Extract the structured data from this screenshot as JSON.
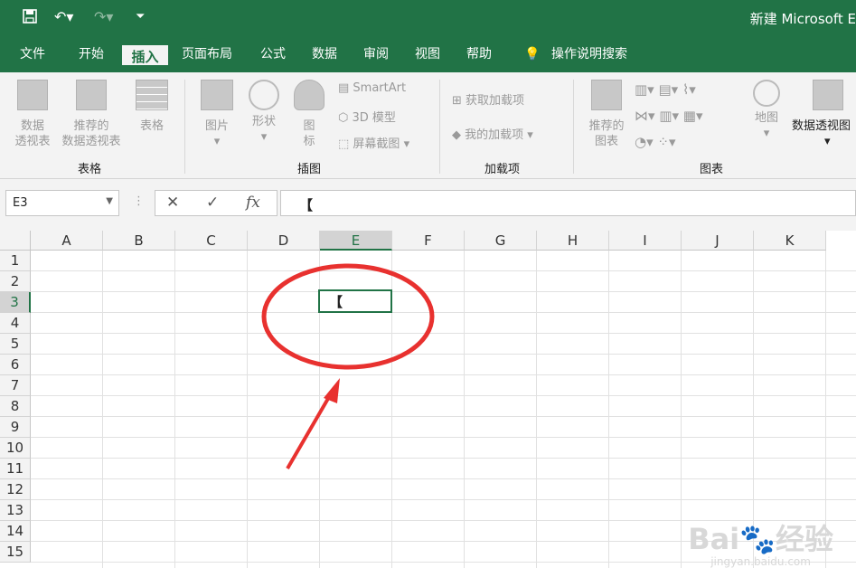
{
  "title_bar": {
    "title": "新建 Microsoft E"
  },
  "tabs": [
    "文件",
    "开始",
    "插入",
    "页面布局",
    "公式",
    "数据",
    "审阅",
    "视图",
    "帮助"
  ],
  "active_tab": "插入",
  "tell_me": "操作说明搜索",
  "ribbon": {
    "tables": {
      "pivot": "数据\n透视表",
      "recommended": "推荐的\n数据透视表",
      "table": "表格",
      "group": "表格"
    },
    "illustrations": {
      "picture": "图片",
      "shapes": "形状",
      "icons": "图\n标",
      "smartart": "SmartArt",
      "model3d": "3D 模型",
      "screenshot": "屏幕截图",
      "group": "插图"
    },
    "addins": {
      "get": "获取加载项",
      "my": "我的加载项",
      "group": "加载项"
    },
    "charts": {
      "recommended": "推荐的\n图表",
      "map": "地图",
      "pivot_chart": "数据透视图",
      "group": "图表"
    }
  },
  "formula_bar": {
    "name_box": "E3",
    "fx": "fx",
    "content": "【"
  },
  "columns": [
    "A",
    "B",
    "C",
    "D",
    "E",
    "F",
    "G",
    "H",
    "I",
    "J",
    "K"
  ],
  "rows": [
    "1",
    "2",
    "3",
    "4",
    "5",
    "6",
    "7",
    "8",
    "9",
    "10",
    "11",
    "12",
    "13",
    "14",
    "15"
  ],
  "active_cell": {
    "ref": "E3",
    "value": "【"
  },
  "watermark": {
    "brand": "Bai",
    "brand2": "经验",
    "url": "jingyan.baidu.com"
  },
  "colors": {
    "excel_green": "#217346",
    "annotation_red": "#e8312f"
  }
}
